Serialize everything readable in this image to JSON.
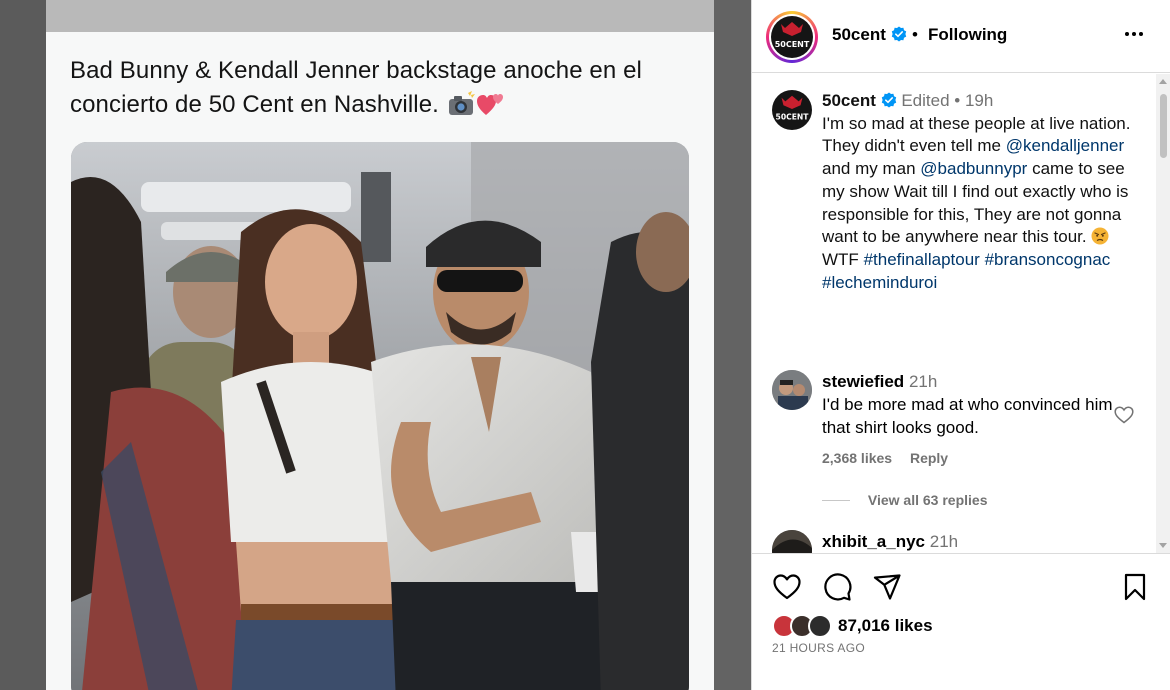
{
  "post": {
    "tweet_text": "Bad Bunny & Kendall Jenner backstage anoche en el concierto de 50 Cent en Nashville.",
    "tweet_emojis": [
      "camera-flash-icon",
      "two-hearts-icon"
    ]
  },
  "header": {
    "username": "50cent",
    "separator": "•",
    "follow_status": "Following",
    "avatar_text": "50CENT"
  },
  "caption": {
    "username": "50cent",
    "edited": "Edited",
    "separator": "•",
    "time": "19h",
    "text_1": "I'm so mad at these people at live nation. They didn't even tell me",
    "mention_1": "@kendalljenner",
    "text_2": "and my man",
    "mention_2": "@badbunnypr",
    "text_3": "came to see my show Wait till I find out exactly who is responsible for this, They are not gonna want to be anywhere near this tour.",
    "text_4": "WTF",
    "hashtag_1": "#thefinallaptour",
    "hashtag_2": "#bransoncognac",
    "hashtag_3": "#lecheminduroi"
  },
  "comments": [
    {
      "username": "stewiefied",
      "time": "21h",
      "text": "I'd be more mad at who convinced him that shirt looks good.",
      "likes": "2,368 likes",
      "reply_label": "Reply",
      "view_replies": "View all 63 replies"
    },
    {
      "username": "xhibit_a_nyc",
      "time": "21h"
    }
  ],
  "footer": {
    "likes": "87,016 likes",
    "time_ago": "21 HOURS AGO"
  },
  "icons": [
    "heart-icon",
    "comment-icon",
    "share-icon",
    "bookmark-icon",
    "more-options-icon",
    "verified-badge-icon"
  ],
  "colors": {
    "link": "#00376b",
    "verified": "#0095f6",
    "secondary_text": "#737373",
    "border": "#dbdbdb"
  }
}
